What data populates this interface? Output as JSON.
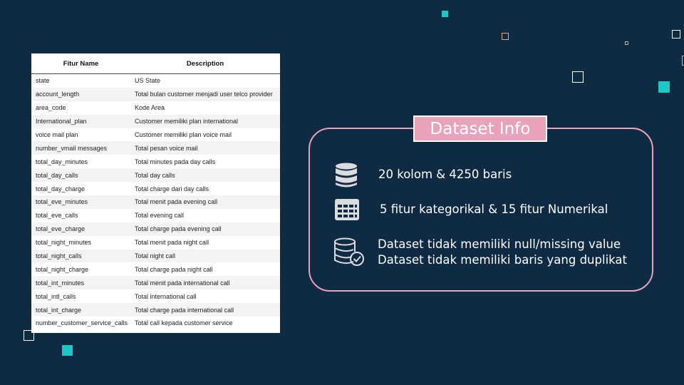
{
  "table": {
    "headers": [
      "Fitur Name",
      "Description"
    ],
    "rows": [
      [
        "state",
        "US State"
      ],
      [
        "account_length",
        "Total bulan customer menjadi user telco provider"
      ],
      [
        "area_code",
        "Kode Area"
      ],
      [
        "International_plan",
        "Customer memiliki plan international"
      ],
      [
        "voice mail plan",
        "Customer memiliki plan voice mail"
      ],
      [
        "number_vmail messages",
        "Total pesan voice mail"
      ],
      [
        "total_day_minutes",
        "Total minutes pada day calls"
      ],
      [
        "total_day_calls",
        "Total day calls"
      ],
      [
        "total_day_charge",
        "Total charge dari day calls"
      ],
      [
        "total_eve_minutes",
        "Total menit pada evening call"
      ],
      [
        "total_eve_calls",
        "Total evening call"
      ],
      [
        "total_eve_charge",
        "Total charge pada evening call"
      ],
      [
        "total_night_minutes",
        "Total menit pada night call"
      ],
      [
        "total_night_calls",
        "Total night call"
      ],
      [
        "total_night_charge",
        "Total charge pada night call"
      ],
      [
        "total_int_minutes",
        "Total menit pada international call"
      ],
      [
        "total_intl_calls",
        "Total international call"
      ],
      [
        "total_int_charge",
        "Total charge pada international call"
      ],
      [
        "number_customer_service_calls",
        "Total call kepada customer service"
      ]
    ]
  },
  "info": {
    "title": "Dataset Info",
    "line1": "20 kolom & 4250 baris",
    "line2": "5 fitur kategorikal & 15 fitur Numerikal",
    "line3": "Dataset tidak memiliki null/missing value",
    "line4": "Dataset tidak memiliki baris yang duplikat"
  },
  "icons": [
    "database-icon",
    "table-grid-icon",
    "database-check-icon"
  ],
  "colors": {
    "background": "#0f2a43",
    "accent_pink": "#e8a3b8",
    "teal": "#1ec7c7",
    "orange": "#f2a574"
  }
}
